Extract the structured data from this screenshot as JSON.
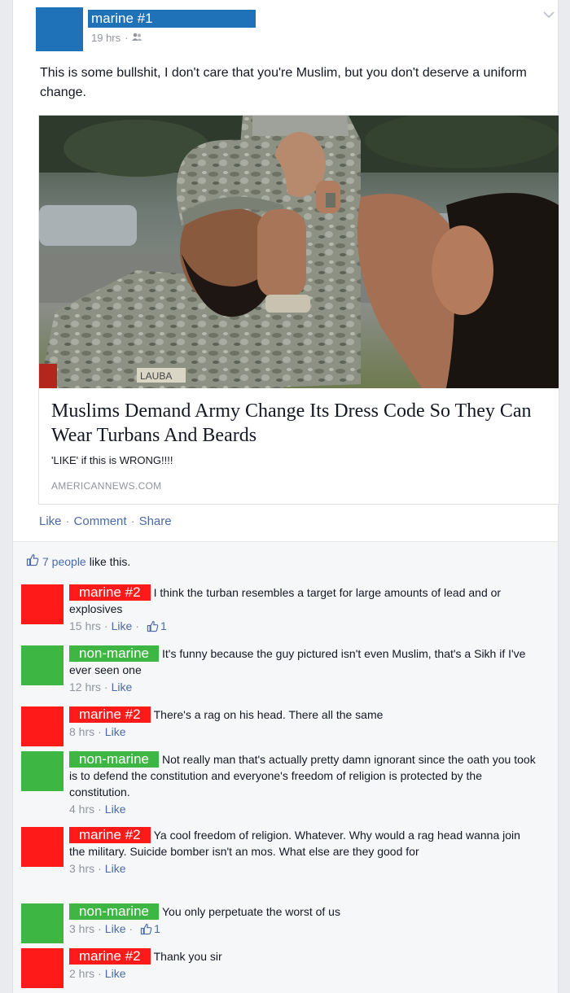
{
  "post": {
    "author": "marine #1",
    "time": "19 hrs",
    "text": "This is some bullshit, I don't care that you're Muslim, but you don't deserve a uniform change.",
    "link": {
      "title": "Muslims Demand Army Change Its Dress Code So They Can Wear Turbans And Beards",
      "description": "'LIKE' if this is WRONG!!!!",
      "domain": "AMERICANNEWS.COM",
      "patch_text": "LAUBA"
    },
    "actions": {
      "like": "Like",
      "comment": "Comment",
      "share": "Share"
    },
    "likes": {
      "count": "7 people",
      "suffix": "like this."
    }
  },
  "colors": {
    "marine1": "#1f71b8",
    "marine2": "#ff1a1a",
    "nonmarine": "#3eb643"
  },
  "comments": [
    {
      "author": "marine #2",
      "color": "red",
      "text": "I think the turban resembles a target for large amounts of lead and or explosives",
      "time": "15 hrs",
      "like": "Like",
      "likes": "1"
    },
    {
      "author": "non-marine",
      "color": "green",
      "text": "It's funny because the guy pictured isn't even Muslim, that's a Sikh if I've ever seen one",
      "time": "12 hrs",
      "like": "Like"
    },
    {
      "author": "marine #2",
      "color": "red",
      "text": "There's a rag on his head. There all the same",
      "time": "8 hrs",
      "like": "Like"
    },
    {
      "author": "non-marine",
      "color": "green",
      "text": "Not really man that's actually pretty damn ignorant since the oath you took is to defend the constitution and everyone's freedom of religion is protected by the constitution.",
      "time": "4 hrs",
      "like": "Like"
    },
    {
      "author": "marine #2",
      "color": "red",
      "text": "Ya cool freedom of religion. Whatever. Why would a rag head wanna join the military. Suicide bomber isn't an mos. What else are they good for",
      "time": "3 hrs",
      "like": "Like"
    },
    {
      "author": "non-marine",
      "color": "green",
      "text": "You only perpetuate the worst of us",
      "time": "3 hrs",
      "like": "Like",
      "likes": "1"
    },
    {
      "author": "marine #2",
      "color": "red",
      "text": "Thank you sir",
      "time": "2 hrs",
      "like": "Like"
    }
  ]
}
